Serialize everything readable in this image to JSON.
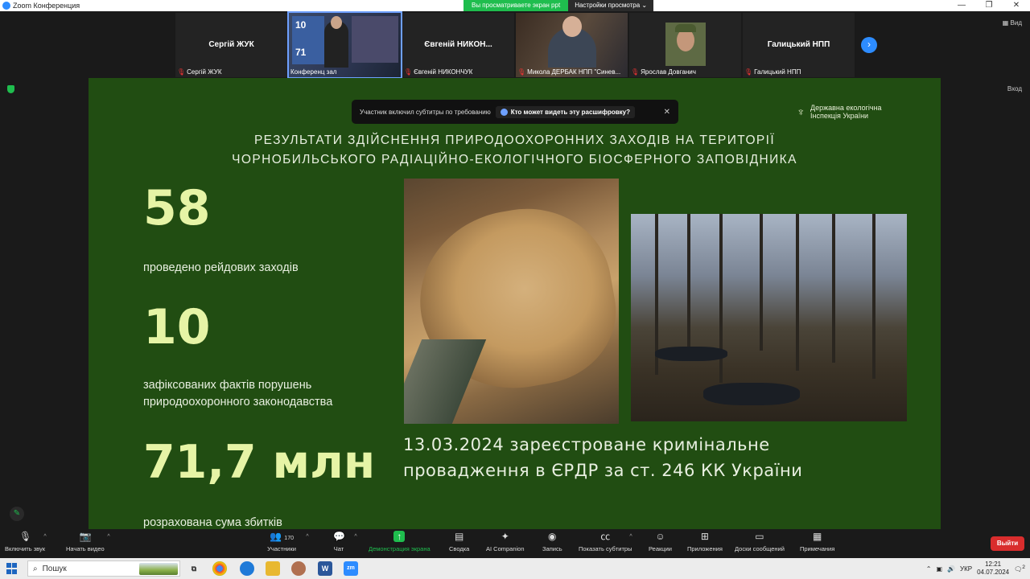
{
  "window": {
    "title": "Zoom Конференция",
    "controls": [
      "—",
      "❐",
      "✕"
    ]
  },
  "share_banner": {
    "status": "Вы просматриваете экран ppt",
    "settings": "Настройки просмотра"
  },
  "view_label": "Вид",
  "exit_side_label": "Вход",
  "participants": [
    {
      "display": "Сергій ЖУК",
      "caption": "Сергій ЖУК"
    },
    {
      "display": "",
      "caption": "Конференц зал"
    },
    {
      "display": "Євгеній  НИКОН...",
      "caption": "Євгеній НИКОНЧУК"
    },
    {
      "display": "",
      "caption": "Микола ДЕРБАК НПП \"Синев..."
    },
    {
      "display": "",
      "caption": "Ярослав Довганич"
    },
    {
      "display": "Галицький НПП",
      "caption": "Галицький НПП"
    }
  ],
  "video_screen": {
    "line1": "10",
    "line2": "71"
  },
  "cc_popup": {
    "text": "Участник включил субтитры по требованию",
    "who": "Кто может видеть эту расшифровку?"
  },
  "slide": {
    "org_line1": "Державна екологічна",
    "org_line2": "Інспекція України",
    "headline_1": "РЕЗУЛЬТАТИ ЗДІЙСНЕННЯ ПРИРОДООХОРОННИХ ЗАХОДІВ НА ТЕРИТОРІЇ",
    "headline_2": "ЧОРНОБИЛЬСЬКОГО РАДІАЦІЙНО-ЕКОЛОГІЧНОГО БІОСФЕРНОГО ЗАПОВІДНИКА",
    "stats": [
      {
        "value": "58",
        "label_1": "проведено рейдових заходів",
        "label_2": ""
      },
      {
        "value": "10",
        "label_1": "зафіксованих фактів порушень",
        "label_2": "природоохоронного законодавства"
      },
      {
        "value": "71,7 млн",
        "label_1": "розрахована сума збитків",
        "label_2": ""
      }
    ],
    "case_line1": "13.03.2024 зареєстроване кримінальне",
    "case_line2": "провадження  в ЄРДР  за ст. 246 КК України"
  },
  "toolbar": {
    "mute": "Включить звук",
    "video": "Начать видео",
    "participants": "Участники",
    "participants_count": "170",
    "chat": "Чат",
    "share": "Демонстрация экрана",
    "summary": "Сводка",
    "ai": "AI Companion",
    "record": "Запись",
    "captions": "Показать субтитры",
    "reactions": "Реакции",
    "apps": "Приложения",
    "whiteboards": "Доски сообщений",
    "notes": "Примечания",
    "leave": "Выйти"
  },
  "taskbar": {
    "search": "Пошук",
    "language": "УКР",
    "time": "12:21",
    "date": "04.07.2024",
    "notifications": "2"
  },
  "colors": {
    "slide_bg": "#214d12",
    "stat_number": "#e6f4a6",
    "zoom_blue": "#2d8cff",
    "zoom_green": "#1fbd4e",
    "leave_red": "#d92d2d"
  }
}
